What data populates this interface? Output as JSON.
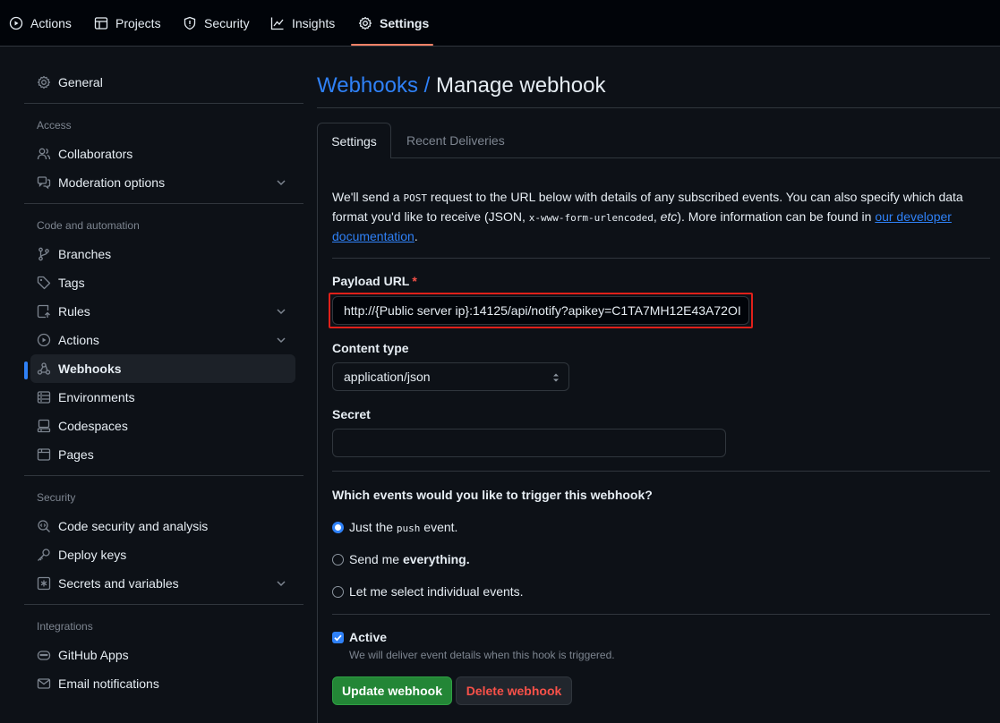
{
  "topnav": {
    "actions": "Actions",
    "projects": "Projects",
    "security": "Security",
    "insights": "Insights",
    "settings": "Settings"
  },
  "sidebar": {
    "general": "General",
    "headings": {
      "access": "Access",
      "code_automation": "Code and automation",
      "security": "Security",
      "integrations": "Integrations"
    },
    "items": {
      "collaborators": "Collaborators",
      "moderation": "Moderation options",
      "branches": "Branches",
      "tags": "Tags",
      "rules": "Rules",
      "actions": "Actions",
      "webhooks": "Webhooks",
      "environments": "Environments",
      "codespaces": "Codespaces",
      "pages": "Pages",
      "code_security": "Code security and analysis",
      "deploy_keys": "Deploy keys",
      "secrets": "Secrets and variables",
      "github_apps": "GitHub Apps",
      "email_notifications": "Email notifications"
    }
  },
  "main": {
    "breadcrumb": "Webhooks /",
    "title": "Manage webhook",
    "tabs": {
      "settings": "Settings",
      "recent": "Recent Deliveries"
    },
    "intro": {
      "part1": "We'll send a ",
      "post": "POST",
      "part2": " request to the URL below with details of any subscribed events. You can also specify which data format you'd like to receive (JSON, ",
      "urlencoded": "x-www-form-urlencoded",
      "part3": ", ",
      "etc": "etc",
      "part4": "). More information can be found in ",
      "link": "our developer documentation",
      "part5": "."
    },
    "payload_label": "Payload URL",
    "required_mark": "*",
    "payload_value": "http://{Public server ip}:14125/api/notify?apikey=C1TA7MH12E43A72OI",
    "content_type_label": "Content type",
    "content_type_value": "application/json",
    "secret_label": "Secret",
    "secret_value": "",
    "events_question": "Which events would you like to trigger this webhook?",
    "events": {
      "push_pre": "Just the ",
      "push_code": "push",
      "push_post": " event.",
      "everything_pre": "Send me ",
      "everything_bold": "everything.",
      "individual": "Let me select individual events."
    },
    "active_label": "Active",
    "active_hint": "We will deliver event details when this hook is triggered.",
    "update_button": "Update webhook",
    "delete_button": "Delete webhook"
  },
  "colors": {
    "accent": "#2f81f7",
    "nav_underline": "#f78166",
    "success": "#238636",
    "danger": "#f85149",
    "highlight": "#e0201a"
  }
}
